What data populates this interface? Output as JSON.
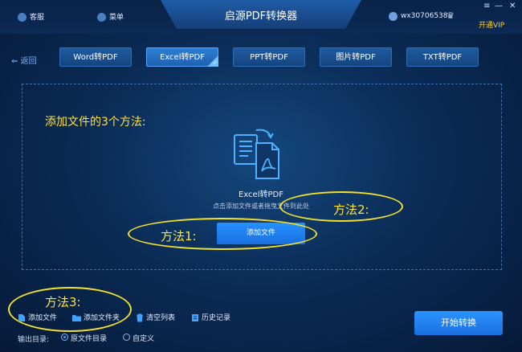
{
  "window": {
    "title": "启源PDF转换器",
    "support_label": "客服",
    "menu_label": "菜单",
    "username": "wx30706538",
    "vip_label": "开通VIP",
    "controls": {
      "settings": "≡",
      "minimize": "—",
      "close": "✕"
    }
  },
  "nav": {
    "back_label": "返回",
    "tabs": [
      {
        "label": "Word转PDF",
        "active": false
      },
      {
        "label": "Excel转PDF",
        "active": true
      },
      {
        "label": "PPT转PDF",
        "active": false
      },
      {
        "label": "图片转PDF",
        "active": false
      },
      {
        "label": "TXT转PDF",
        "active": false
      }
    ]
  },
  "dropzone": {
    "methods_heading": "添加文件的3个方法:",
    "title": "Excel转PDF",
    "hint": "点击添加文件或者拖曳文件到此处",
    "add_file_button": "添加文件"
  },
  "annotations": {
    "method1": "方法1:",
    "method2": "方法2:",
    "method3": "方法3:"
  },
  "toolbar": {
    "add_file": "添加文件",
    "add_folder": "添加文件夹",
    "clear_list": "清空列表",
    "history": "历史记录"
  },
  "output": {
    "label": "输出目录:",
    "options": [
      {
        "label": "原文件目录",
        "selected": true
      },
      {
        "label": "自定义",
        "selected": false
      }
    ]
  },
  "start_button": "开始转换",
  "colors": {
    "accent_blue": "#1a6fe0",
    "annotation_yellow": "#ffe13a",
    "vip_yellow": "#ffd23a"
  }
}
